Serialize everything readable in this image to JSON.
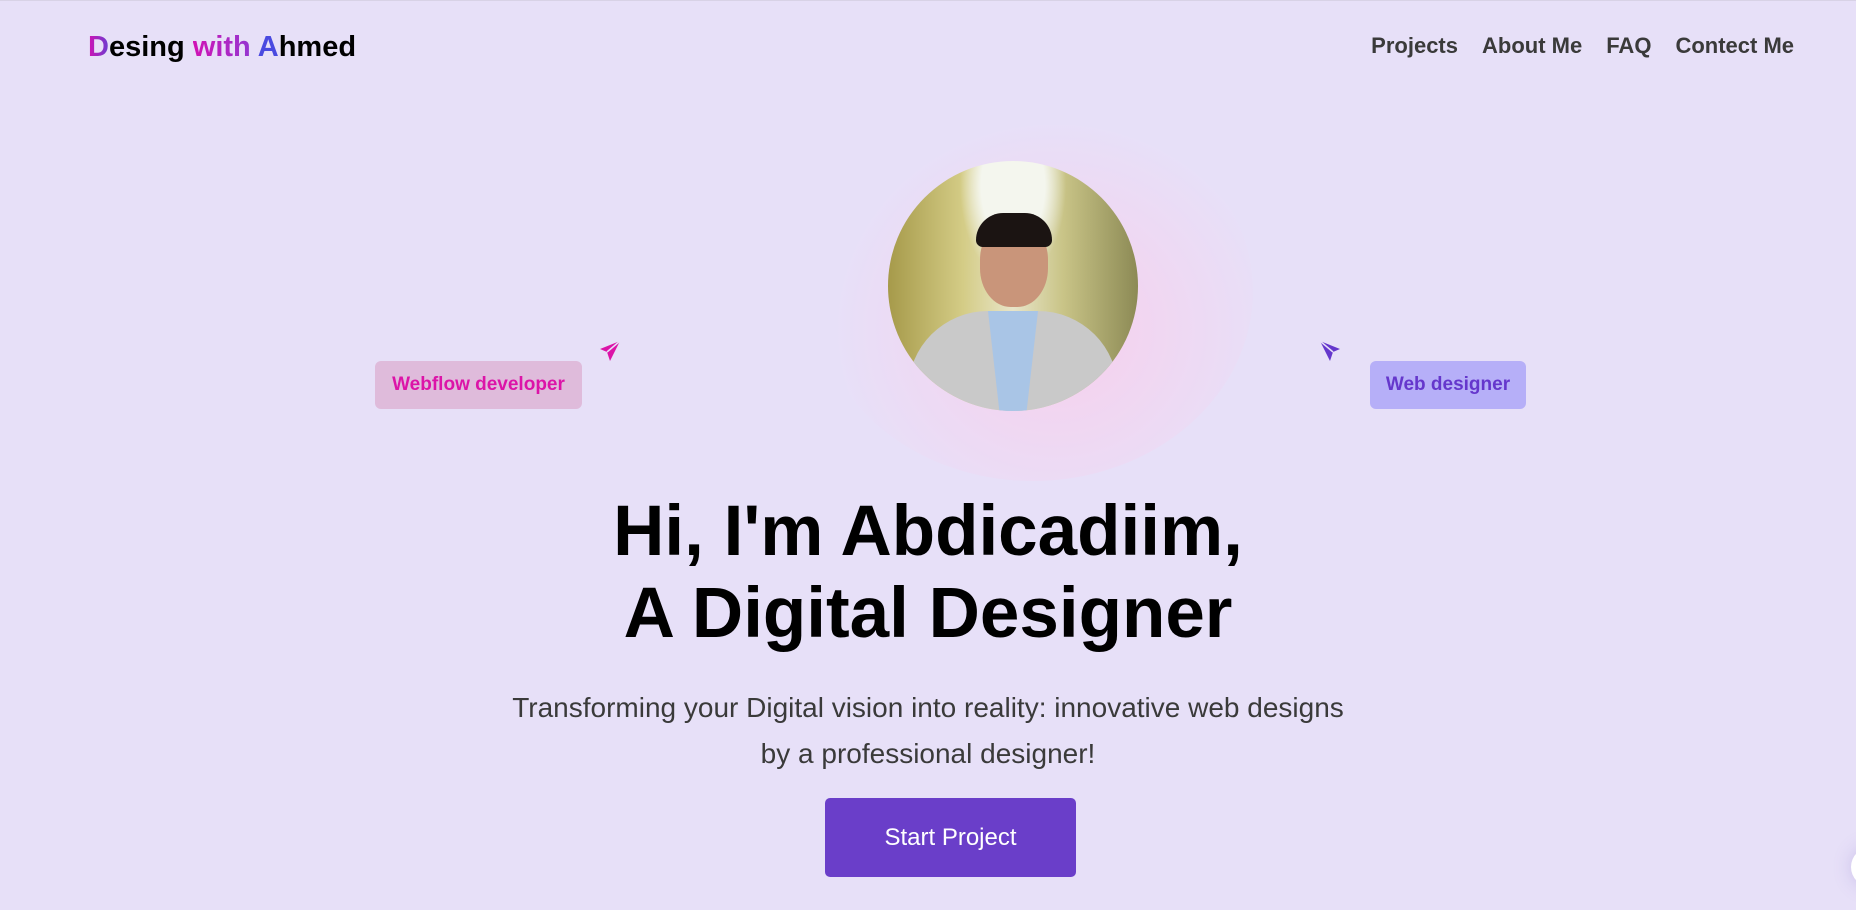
{
  "header": {
    "logo": {
      "first_letter": "D",
      "part1": "esing ",
      "with": "with ",
      "a_letter": "A",
      "part2": "hmed"
    },
    "nav": [
      {
        "label": "Projects"
      },
      {
        "label": "About Me"
      },
      {
        "label": "FAQ"
      },
      {
        "label": "Contect Me"
      }
    ]
  },
  "hero": {
    "tags": [
      {
        "label": "Webflow developer",
        "icon": "paper-plane-icon"
      },
      {
        "label": "Web designer",
        "icon": "paper-plane-icon"
      }
    ],
    "title_line1": "Hi, I'm Abdicadiim,",
    "title_line2": "A Digital Designer",
    "subtitle_line1": "Transforming your Digital vision into reality: innovative web designs",
    "subtitle_line2": "by a professional designer!",
    "cta_label": "Start Project"
  },
  "colors": {
    "background": "#e7e0f8",
    "accent": "#6a3ec9",
    "pink": "#dc14a8"
  }
}
